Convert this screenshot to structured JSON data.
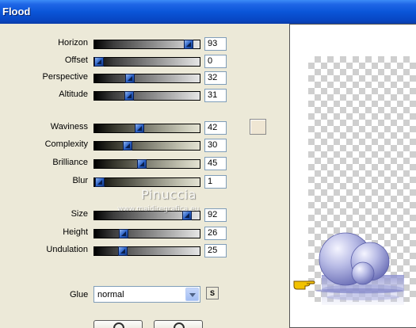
{
  "window": {
    "title": "Flood"
  },
  "sliders": [
    {
      "id": "horizon",
      "label": "Horizon",
      "value": "93",
      "fraction": 0.93,
      "style": "gray"
    },
    {
      "id": "offset",
      "label": "Offset",
      "value": "0",
      "fraction": 0.0,
      "style": "gray"
    },
    {
      "id": "perspective",
      "label": "Perspective",
      "value": "32",
      "fraction": 0.32,
      "style": "gray"
    },
    {
      "id": "altitude",
      "label": "Altitude",
      "value": "31",
      "fraction": 0.31,
      "style": "gray"
    },
    {
      "id": "waviness",
      "label": "Waviness",
      "value": "42",
      "fraction": 0.42,
      "style": "beige"
    },
    {
      "id": "complexity",
      "label": "Complexity",
      "value": "30",
      "fraction": 0.3,
      "style": "beige"
    },
    {
      "id": "brilliance",
      "label": "Brilliance",
      "value": "45",
      "fraction": 0.45,
      "style": "beige"
    },
    {
      "id": "blur",
      "label": "Blur",
      "value": "1",
      "fraction": 0.01,
      "style": "beige"
    },
    {
      "id": "size",
      "label": "Size",
      "value": "92",
      "fraction": 0.92,
      "style": "gray"
    },
    {
      "id": "height",
      "label": "Height",
      "value": "26",
      "fraction": 0.26,
      "style": "gray"
    },
    {
      "id": "undulation",
      "label": "Undulation",
      "value": "25",
      "fraction": 0.25,
      "style": "gray"
    }
  ],
  "color_swatch": {
    "color": "#efe6d3"
  },
  "glue": {
    "label": "Glue",
    "value": "normal",
    "s_button": "S"
  },
  "watermark": {
    "line1": "Pinuccia",
    "line2": "www.maidiregrafica.eu"
  },
  "icons": {
    "pointer": "pointing-hand-icon"
  }
}
